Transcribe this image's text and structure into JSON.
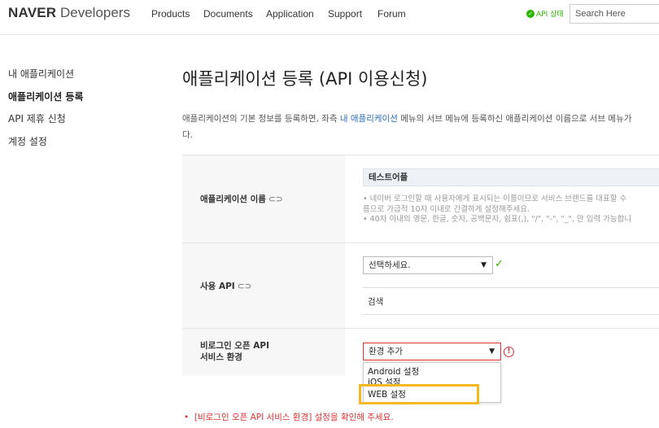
{
  "header": {
    "logo_bold": "NAVER",
    "logo_light": "Developers",
    "nav": [
      "Products",
      "Documents",
      "Application",
      "Support",
      "Forum"
    ],
    "api_status": "API 상태",
    "search_placeholder": "Search Here"
  },
  "sidebar": {
    "items": [
      {
        "label": "내 애플리케이션"
      },
      {
        "label": "애플리케이션 등록"
      },
      {
        "label": "API 제휴 신청"
      },
      {
        "label": "계정 설정"
      }
    ],
    "active_index": 1
  },
  "main": {
    "title": "애플리케이션 등록 (API 이용신청)",
    "desc_part1": "애플리케이션의 기본 정보를 등록하면, 좌측 ",
    "desc_link": "내 애플리케이션",
    "desc_part2": " 메뉴의 서브 메뉴에 등록하신 애플리케이션 이름으로 서브 메뉴가",
    "desc_line2": "다."
  },
  "form": {
    "app_name": {
      "label": "애플리케이션 이름",
      "value": "테스트어플",
      "hint1": "• 네이버 로그인할 때 사용자에게 표시되는 이름이므로 서비스 브랜드를 대표할 수",
      "hint2": "  름으로 가급적 10자 이내로 간결하게 설정해주세요.",
      "hint3": "• 40자 이내의 영문, 한글, 숫자, 공백문자, 쉼표(,), \"/\", \"-\", \"_\", 만 입력 가능합니"
    },
    "api": {
      "label": "사용 API",
      "select_value": "선택하세요.",
      "selected_api": "검색"
    },
    "env": {
      "label_line1": "비로그인 오픈 API",
      "label_line2": "서비스 환경",
      "select_value": "환경 추가",
      "options": [
        "Android 설정",
        "iOS 설정",
        "WEB 설정"
      ]
    },
    "error_message": "[비로그인 오픈 API 서비스 환경] 설정을 확인해 주세요."
  },
  "colors": {
    "brand_green": "#2db400",
    "link_blue": "#2c6db5",
    "error_red": "#d33333",
    "highlight_yellow": "#f5b820"
  },
  "icons": {
    "link": "link-icon",
    "check": "check-icon",
    "error": "error-icon",
    "dropdown": "chevron-down-icon"
  }
}
